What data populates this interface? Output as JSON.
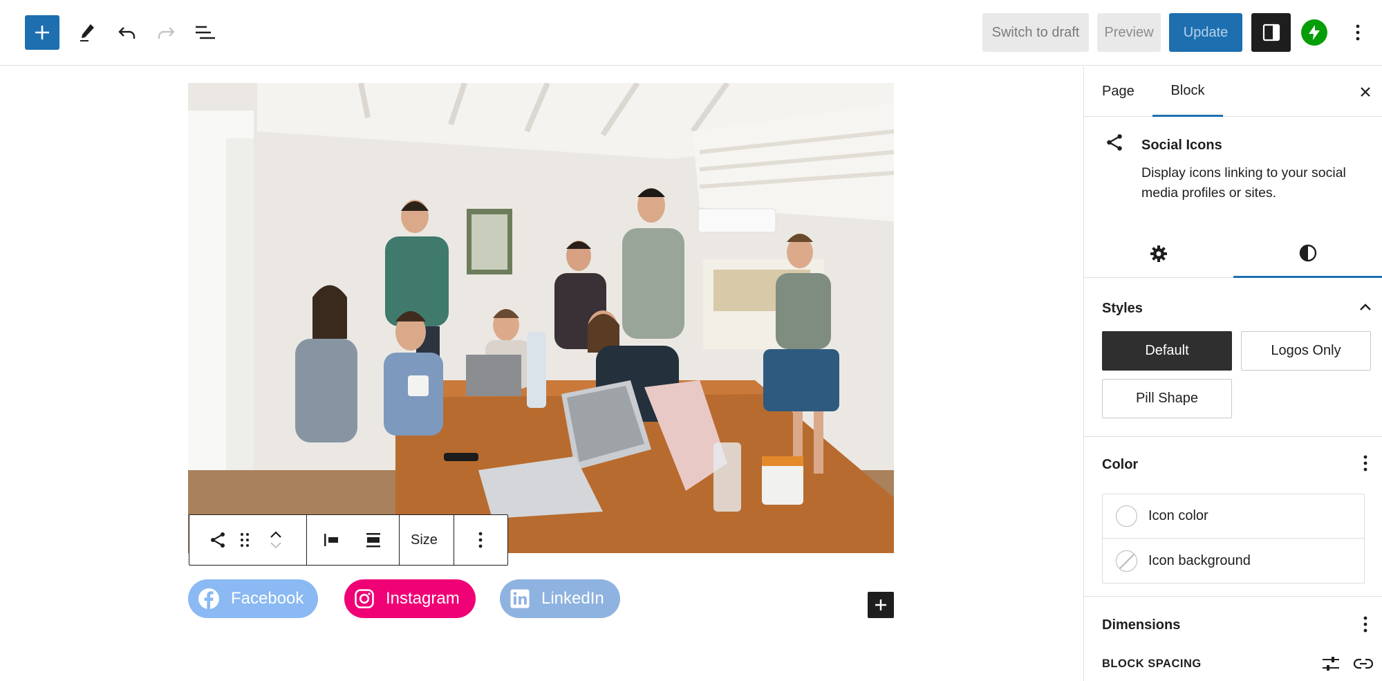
{
  "toolbar": {
    "add_icon": "plus-icon",
    "tools_icon": "pencil-icon",
    "undo_icon": "undo-icon",
    "redo_icon": "redo-icon",
    "list_view_icon": "list-view-icon",
    "switch_to_draft_label": "Switch to draft",
    "preview_label": "Preview",
    "update_label": "Update",
    "settings_icon": "sidebar-toggle-icon",
    "jetpack_icon": "jetpack-bolt-icon",
    "options_icon": "more-vertical-icon",
    "accent_color": "#1d6fb0"
  },
  "block_toolbar": {
    "block_type_icon": "share-icon",
    "drag_icon": "drag-handle-icon",
    "move_up_icon": "chevron-up-icon",
    "move_down_icon": "chevron-down-icon",
    "justify_left_icon": "justify-left-icon",
    "justify_center_icon": "justify-center-icon",
    "size_label": "Size",
    "options_icon": "more-vertical-icon"
  },
  "social_links": [
    {
      "label": "Facebook",
      "icon": "facebook-icon",
      "color": "#8ab9f3"
    },
    {
      "label": "Instagram",
      "icon": "instagram-icon",
      "color": "#f00075"
    },
    {
      "label": "LinkedIn",
      "icon": "linkedin-icon",
      "color": "#8fb3e0"
    }
  ],
  "sidebar": {
    "tabs": [
      {
        "label": "Page",
        "active": false
      },
      {
        "label": "Block",
        "active": true
      }
    ],
    "close_icon": "close-icon",
    "block_card": {
      "icon": "share-icon",
      "title": "Social Icons",
      "description": "Display icons linking to your social media profiles or sites."
    },
    "inspector_tabs": [
      {
        "icon": "gear-icon",
        "active": false
      },
      {
        "icon": "contrast-icon",
        "active": true
      }
    ],
    "styles": {
      "title": "Styles",
      "options": [
        {
          "label": "Default",
          "active": true
        },
        {
          "label": "Logos Only",
          "active": false
        },
        {
          "label": "Pill Shape",
          "active": false
        }
      ]
    },
    "color": {
      "title": "Color",
      "items": [
        {
          "label": "Icon color"
        },
        {
          "label": "Icon background"
        }
      ]
    },
    "dimensions": {
      "title": "Dimensions",
      "block_spacing_label": "BLOCK SPACING"
    }
  }
}
